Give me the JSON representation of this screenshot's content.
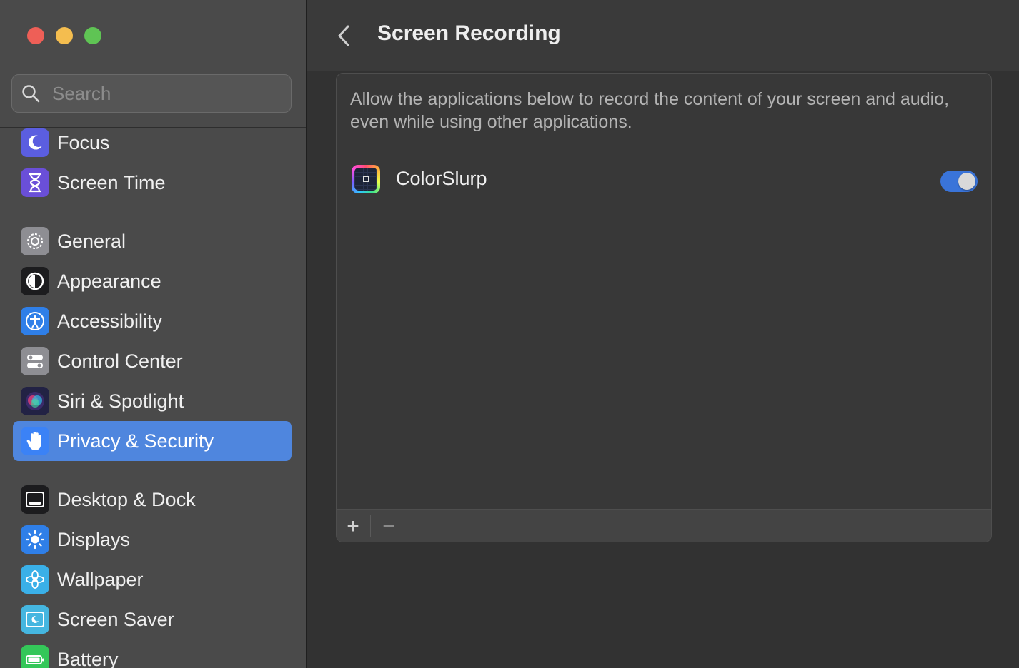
{
  "window": {
    "controls": [
      "close",
      "minimize",
      "zoom"
    ]
  },
  "search": {
    "placeholder": "Search"
  },
  "sidebar": {
    "items": [
      {
        "label": "Focus",
        "icon": "moon-icon",
        "color": "#5b5ee0"
      },
      {
        "label": "Screen Time",
        "icon": "hourglass-icon",
        "color": "#6a4fd8"
      },
      {
        "label": "General",
        "icon": "gear-icon",
        "color": "#8e8e93"
      },
      {
        "label": "Appearance",
        "icon": "appearance-icon",
        "color": "#1c1c1e"
      },
      {
        "label": "Accessibility",
        "icon": "accessibility-icon",
        "color": "#2f7fe8"
      },
      {
        "label": "Control Center",
        "icon": "toggles-icon",
        "color": "#8e8e93"
      },
      {
        "label": "Siri & Spotlight",
        "icon": "siri-icon",
        "color": "#222244"
      },
      {
        "label": "Privacy & Security",
        "icon": "hand-icon",
        "color": "#3b82f6",
        "active": true
      },
      {
        "label": "Desktop & Dock",
        "icon": "dock-icon",
        "color": "#1c1c1e"
      },
      {
        "label": "Displays",
        "icon": "sun-icon",
        "color": "#2f7fe8"
      },
      {
        "label": "Wallpaper",
        "icon": "flower-icon",
        "color": "#3ab0e8"
      },
      {
        "label": "Screen Saver",
        "icon": "screensaver-icon",
        "color": "#45b6e0"
      },
      {
        "label": "Battery",
        "icon": "battery-icon",
        "color": "#34c759"
      }
    ]
  },
  "header": {
    "title": "Screen Recording"
  },
  "panel": {
    "description": "Allow the applications below to record the content of your screen and audio, even while using other applications.",
    "apps": [
      {
        "name": "ColorSlurp",
        "enabled": true
      }
    ],
    "add_label": "+",
    "remove_label": "−"
  },
  "colors": {
    "accent": "#4f86de",
    "toggle_on": "#3a74d9"
  }
}
